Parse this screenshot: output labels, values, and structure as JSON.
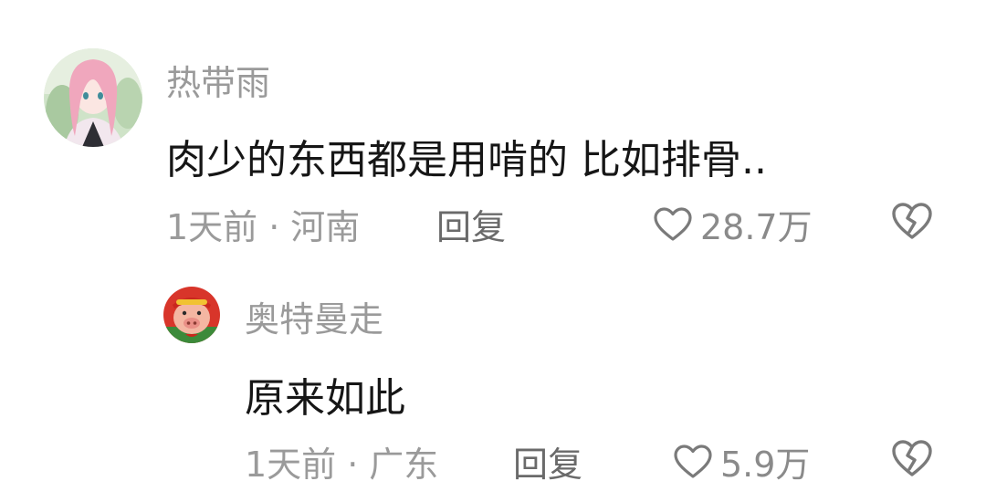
{
  "comments": [
    {
      "username": "热带雨",
      "text": "肉少的东西都是用啃的 比如排骨..",
      "time": "1天前",
      "separator": "·",
      "location": "河南",
      "reply_label": "回复",
      "likes": "28.7万",
      "avatar_icon": "anime-girl-avatar",
      "like_icon": "heart-outline-icon",
      "dislike_icon": "broken-heart-icon"
    },
    {
      "username": "奥特曼走",
      "text": "原来如此",
      "time": "1天前",
      "separator": "·",
      "location": "广东",
      "reply_label": "回复",
      "likes": "5.9万",
      "avatar_icon": "cartoon-pig-avatar",
      "like_icon": "heart-outline-icon",
      "dislike_icon": "broken-heart-icon"
    }
  ],
  "colors": {
    "text": "#161616",
    "secondary": "#9a9a9a",
    "reply": "#6a6a6a",
    "background": "#ffffff"
  }
}
